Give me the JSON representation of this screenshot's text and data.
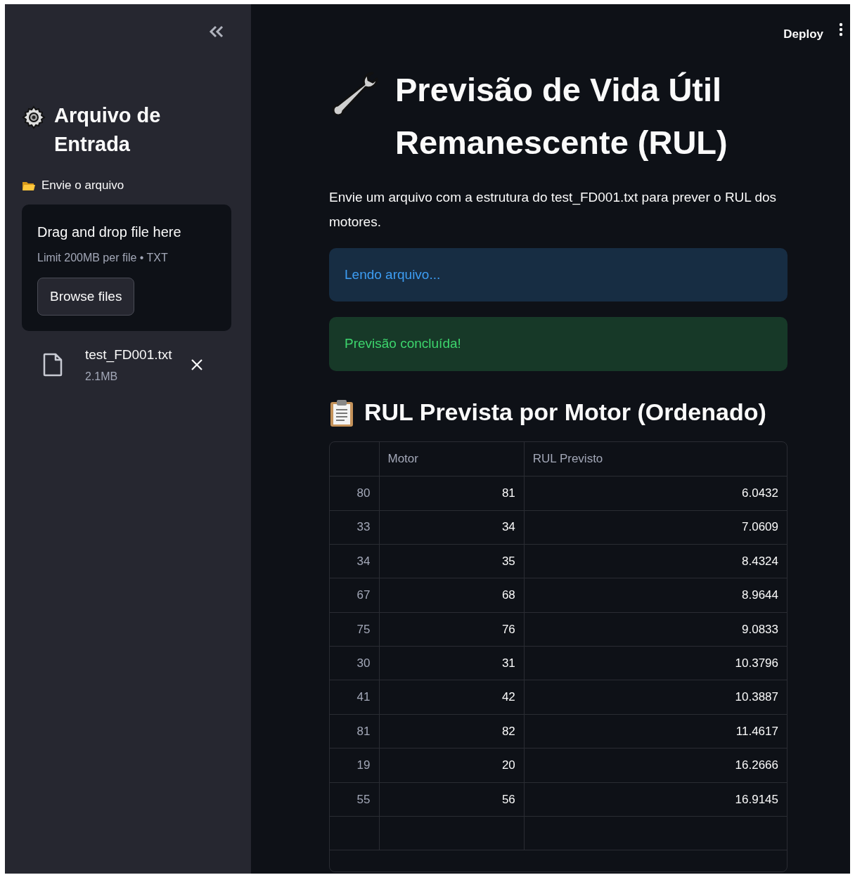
{
  "header": {
    "deploy_button": "Deploy"
  },
  "sidebar": {
    "title": "Arquivo de Entrada",
    "uploader": {
      "label": "Envie o arquivo",
      "dropzone_title": "Drag and drop file here",
      "dropzone_hint": "Limit 200MB per file • TXT",
      "browse_button": "Browse files"
    },
    "files": [
      {
        "name": "test_FD001.txt",
        "size": "2.1MB"
      }
    ]
  },
  "main": {
    "title": "Previsão de Vida Útil Remanescente (RUL)",
    "description": "Envie um arquivo com a estrutura do test_FD001.txt para prever o RUL dos motores.",
    "alerts": [
      {
        "kind": "info",
        "text": "Lendo arquivo..."
      },
      {
        "kind": "success",
        "text": "Previsão concluída!"
      }
    ],
    "table_title": "RUL Prevista por Motor (Ordenado)",
    "table": {
      "columns": [
        "Motor",
        "RUL Previsto"
      ],
      "rows": [
        {
          "index": "80",
          "values": [
            "81",
            "6.0432"
          ]
        },
        {
          "index": "33",
          "values": [
            "34",
            "7.0609"
          ]
        },
        {
          "index": "34",
          "values": [
            "35",
            "8.4324"
          ]
        },
        {
          "index": "67",
          "values": [
            "68",
            "8.9644"
          ]
        },
        {
          "index": "75",
          "values": [
            "76",
            "9.0833"
          ]
        },
        {
          "index": "30",
          "values": [
            "31",
            "10.3796"
          ]
        },
        {
          "index": "41",
          "values": [
            "42",
            "10.3887"
          ]
        },
        {
          "index": "81",
          "values": [
            "82",
            "11.4617"
          ]
        },
        {
          "index": "19",
          "values": [
            "20",
            "16.2666"
          ]
        },
        {
          "index": "55",
          "values": [
            "56",
            "16.9145"
          ]
        }
      ]
    }
  }
}
